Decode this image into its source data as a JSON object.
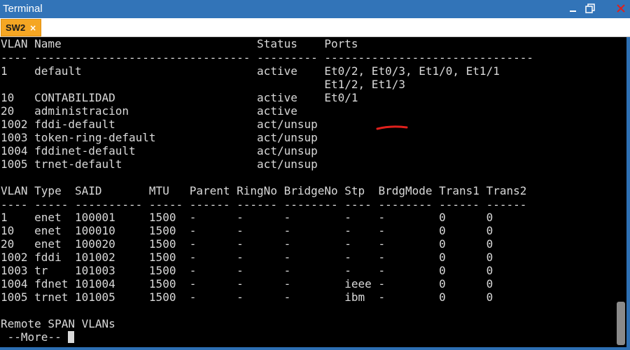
{
  "window": {
    "title": "Terminal",
    "controls": [
      "minimize-icon",
      "restore-icon",
      "close-icon"
    ]
  },
  "tab": {
    "label": "SW2",
    "close": "×"
  },
  "terminal": {
    "lines": [
      "VLAN Name                             Status    Ports",
      "---- -------------------------------- --------- -------------------------------",
      "1    default                          active    Et0/2, Et0/3, Et1/0, Et1/1",
      "                                                Et1/2, Et1/3",
      "10   CONTABILIDAD                     active    Et0/1",
      "20   administracion                   active",
      "1002 fddi-default                     act/unsup",
      "1003 token-ring-default               act/unsup",
      "1004 fddinet-default                  act/unsup",
      "1005 trnet-default                    act/unsup",
      "",
      "VLAN Type  SAID       MTU   Parent RingNo BridgeNo Stp  BrdgMode Trans1 Trans2",
      "---- ----- ---------- ----- ------ ------ -------- ---- -------- ------ ------",
      "1    enet  100001     1500  -      -      -        -    -        0      0",
      "10   enet  100010     1500  -      -      -        -    -        0      0",
      "20   enet  100020     1500  -      -      -        -    -        0      0",
      "1002 fddi  101002     1500  -      -      -        -    -        0      0",
      "1003 tr    101003     1500  -      -      -        -    -        0      0",
      "1004 fdnet 101004     1500  -      -      -        ieee -        0      0",
      "1005 trnet 101005     1500  -      -      -        ibm  -        0      0",
      "",
      "Remote SPAN VLANs",
      " --More-- "
    ]
  },
  "colors": {
    "titlebar": "#3274b8",
    "tab": "#f5a623",
    "terminal_bg": "#000000",
    "terminal_fg": "#d9d9d9",
    "annotation": "#e0201c"
  }
}
